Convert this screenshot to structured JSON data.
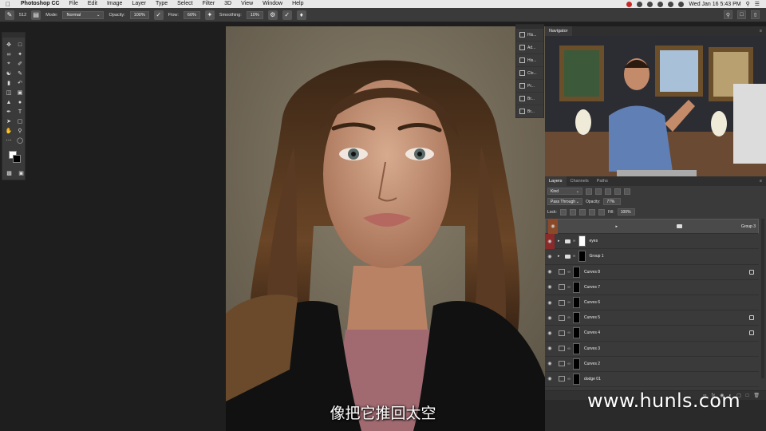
{
  "menubar": {
    "app": "Photoshop CC",
    "items": [
      "File",
      "Edit",
      "Image",
      "Layer",
      "Type",
      "Select",
      "Filter",
      "3D",
      "View",
      "Window",
      "Help"
    ],
    "datetime": "Wed Jan 16  5:43 PM"
  },
  "options": {
    "brush_size": "512",
    "mode_label": "Mode:",
    "mode_value": "Normal",
    "opacity_label": "Opacity:",
    "opacity_value": "100%",
    "flow_label": "Flow:",
    "flow_value": "60%",
    "smoothing_label": "Smoothing:",
    "smoothing_value": "10%"
  },
  "dock": {
    "items": [
      "His...",
      "Ad...",
      "His...",
      "Clo...",
      "Pr...",
      "Br...",
      "Br..."
    ]
  },
  "navigator": {
    "title": "Navigator"
  },
  "layers_panel": {
    "tabs": [
      "Layers",
      "Channels",
      "Paths"
    ],
    "kind_value": "Kind",
    "blend_value": "Pass Through",
    "opacity_label": "Opacity:",
    "opacity_value": "77%",
    "lock_label": "Lock:",
    "fill_label": "Fill:",
    "fill_value": "100%",
    "layers": [
      {
        "name": "Group 3",
        "type": "group",
        "selected": true,
        "eye": "orange",
        "mask": "",
        "fx": false
      },
      {
        "name": "eyes",
        "type": "group",
        "selected": false,
        "eye": "red",
        "mask": "white",
        "fx": false
      },
      {
        "name": "Group 1",
        "type": "group",
        "selected": false,
        "eye": "",
        "mask": "black",
        "fx": false
      },
      {
        "name": "Curves 8",
        "type": "adjustment",
        "selected": false,
        "eye": "",
        "mask": "black",
        "fx": true
      },
      {
        "name": "Curves 7",
        "type": "adjustment",
        "selected": false,
        "eye": "",
        "mask": "black",
        "fx": false
      },
      {
        "name": "Curves 6",
        "type": "adjustment",
        "selected": false,
        "eye": "",
        "mask": "black",
        "fx": false
      },
      {
        "name": "Curves 5",
        "type": "adjustment",
        "selected": false,
        "eye": "",
        "mask": "black",
        "fx": true
      },
      {
        "name": "Curves 4",
        "type": "adjustment",
        "selected": false,
        "eye": "",
        "mask": "black",
        "fx": true
      },
      {
        "name": "Curves 3",
        "type": "adjustment",
        "selected": false,
        "eye": "",
        "mask": "black",
        "fx": false
      },
      {
        "name": "Curves 2",
        "type": "adjustment",
        "selected": false,
        "eye": "",
        "mask": "black",
        "fx": false
      },
      {
        "name": "dodge 01",
        "type": "adjustment",
        "selected": false,
        "eye": "",
        "mask": "black",
        "fx": false
      }
    ]
  },
  "subtitle": "像把它推回太空",
  "watermark": "www.hunls.com"
}
